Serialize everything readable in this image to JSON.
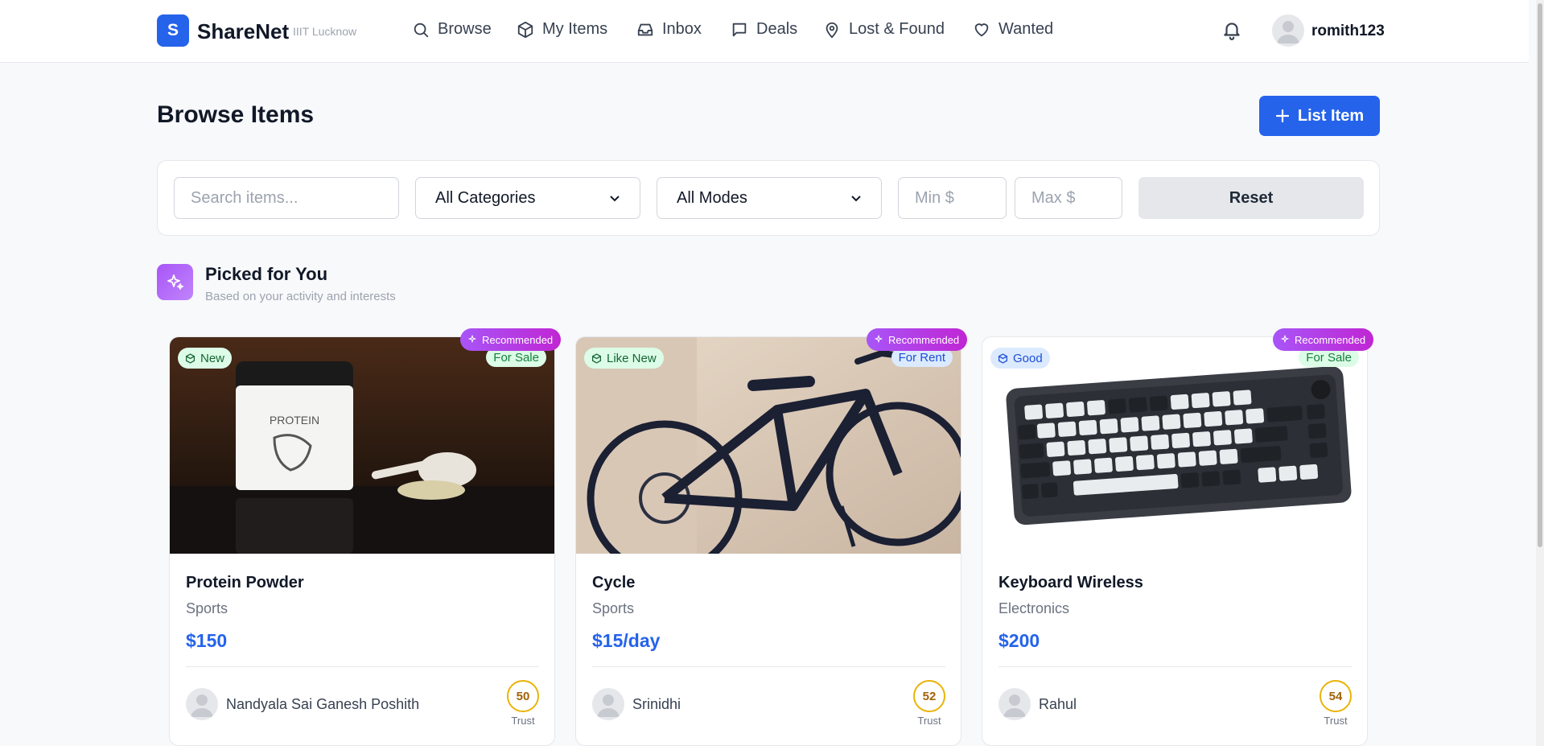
{
  "header": {
    "logo_letter": "S",
    "brand": "ShareNet",
    "campus": "IIIT Lucknow",
    "nav": [
      {
        "label": "Browse",
        "icon": "search-icon"
      },
      {
        "label": "My Items",
        "icon": "box-icon"
      },
      {
        "label": "Inbox",
        "icon": "inbox-icon"
      },
      {
        "label": "Deals",
        "icon": "chat-icon"
      },
      {
        "label": "Lost & Found",
        "icon": "map-pin-icon"
      },
      {
        "label": "Wanted",
        "icon": "heart-icon"
      }
    ],
    "username": "romith123"
  },
  "page": {
    "title": "Browse Items",
    "list_button": "List Item"
  },
  "filters": {
    "search_placeholder": "Search items...",
    "category": "All Categories",
    "mode": "All Modes",
    "min_placeholder": "Min $",
    "max_placeholder": "Max $",
    "reset": "Reset"
  },
  "picked": {
    "title": "Picked for You",
    "subtitle": "Based on your activity and interests"
  },
  "cards": [
    {
      "recommended": "Recommended",
      "condition": "New",
      "mode": "For Sale",
      "title": "Protein Powder",
      "category": "Sports",
      "price": "$150",
      "seller": "Nandyala Sai Ganesh Poshith",
      "trust": "50",
      "trust_label": "Trust"
    },
    {
      "recommended": "Recommended",
      "condition": "Like New",
      "mode": "For Rent",
      "title": "Cycle",
      "category": "Sports",
      "price": "$15/day",
      "seller": "Srinidhi",
      "trust": "52",
      "trust_label": "Trust"
    },
    {
      "recommended": "Recommended",
      "condition": "Good",
      "mode": "For Sale",
      "title": "Keyboard Wireless",
      "category": "Electronics",
      "price": "$200",
      "seller": "Rahul",
      "trust": "54",
      "trust_label": "Trust"
    }
  ],
  "colors": {
    "primary": "#2563eb",
    "recommended": "#a855f7",
    "trust_ring": "#eab308"
  }
}
